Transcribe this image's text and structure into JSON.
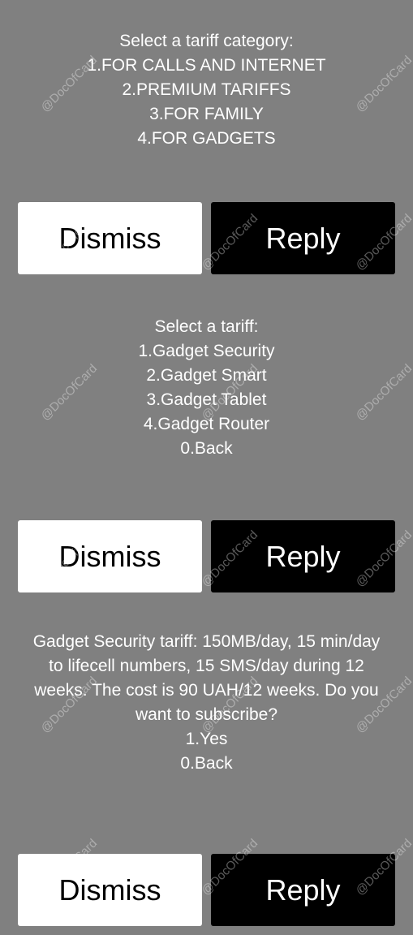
{
  "dialogs": [
    {
      "lines": [
        "Select a tariff category:",
        "1.FOR CALLS AND INTERNET",
        "2.PREMIUM TARIFFS",
        "3.FOR FAMILY",
        "4.FOR GADGETS"
      ],
      "dismiss_label": "Dismiss",
      "reply_label": "Reply"
    },
    {
      "lines": [
        "Select a tariff:",
        "1.Gadget Security",
        "2.Gadget Smart",
        "3.Gadget Tablet",
        "4.Gadget Router",
        "0.Back"
      ],
      "dismiss_label": "Dismiss",
      "reply_label": "Reply"
    },
    {
      "lines": [
        "Gadget Security tariff: 150MB/day, 15 min/day",
        "to lifecell numbers, 15 SMS/day during 12",
        "weeks. The cost is 90 UAH/12 weeks. Do you",
        "want to subscribe?",
        "1.Yes",
        "0.Back"
      ],
      "dismiss_label": "Dismiss",
      "reply_label": "Reply"
    }
  ],
  "watermark": "@DocOfCard"
}
